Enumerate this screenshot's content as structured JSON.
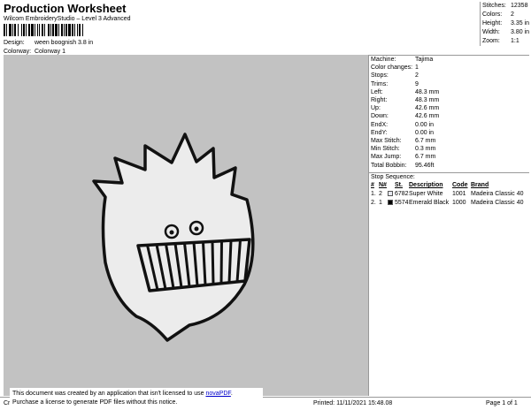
{
  "header": {
    "title": "Production Worksheet",
    "subtitle": "Wilcom EmbroideryStudio – Level 3 Advanced",
    "design_label": "Design:",
    "design_value": "ween boognish 3.8 in",
    "colorway_label": "Colorway:",
    "colorway_value": "Colorway 1"
  },
  "stats": [
    {
      "label": "Stitches:",
      "value": "12358"
    },
    {
      "label": "Colors:",
      "value": "2"
    },
    {
      "label": "Height:",
      "value": "3.35 in"
    },
    {
      "label": "Width:",
      "value": "3.80 in"
    },
    {
      "label": "Zoom:",
      "value": "1:1"
    }
  ],
  "properties": [
    {
      "label": "Machine:",
      "value": "Tajima"
    },
    {
      "label": "Color changes:",
      "value": "1"
    },
    {
      "label": "Stops:",
      "value": "2"
    },
    {
      "label": "Trims:",
      "value": "9"
    },
    {
      "label": "Left:",
      "value": "48.3 mm"
    },
    {
      "label": "Right:",
      "value": "48.3 mm"
    },
    {
      "label": "Up:",
      "value": "42.6 mm"
    },
    {
      "label": "Down:",
      "value": "42.6 mm"
    },
    {
      "label": "EndX:",
      "value": "0.00 in"
    },
    {
      "label": "EndY:",
      "value": "0.00 in"
    },
    {
      "label": "Max Stitch:",
      "value": "6.7 mm"
    },
    {
      "label": "Min Stitch:",
      "value": "0.3 mm"
    },
    {
      "label": "Max Jump:",
      "value": "6.7 mm"
    },
    {
      "label": "Total Bobbin:",
      "value": "95.46ft"
    }
  ],
  "stop_sequence": {
    "title": "Stop Sequence:",
    "headers": {
      "num": "#",
      "n": "N#",
      "st": "St.",
      "desc": "Description",
      "code": "Code",
      "brand": "Brand"
    },
    "rows": [
      {
        "num": "1.",
        "n": "2",
        "color": "#e6e8f0",
        "st": "6782",
        "desc": "Super White",
        "code": "1001",
        "brand": "Madeira Classic 40"
      },
      {
        "num": "2.",
        "n": "1",
        "color": "#000000",
        "st": "5574",
        "desc": "Emerald Black",
        "code": "1000",
        "brand": "Madeira Classic 40"
      }
    ]
  },
  "footer": {
    "left": "Cr",
    "printed": "Printed:  11/11/2021 15:48.08",
    "page": "Page 1 of 1"
  },
  "notice": {
    "line1_prefix": "This document was created by an application that isn't licensed to use ",
    "link": "novaPDF",
    "line1_suffix": ".",
    "line2": "Purchase a license to generate PDF files without this notice."
  },
  "colors": {
    "canvas_bg": "#c2c2c2",
    "fill": "#ececec",
    "outline": "#111111"
  },
  "icons": [
    "boognish-design"
  ]
}
